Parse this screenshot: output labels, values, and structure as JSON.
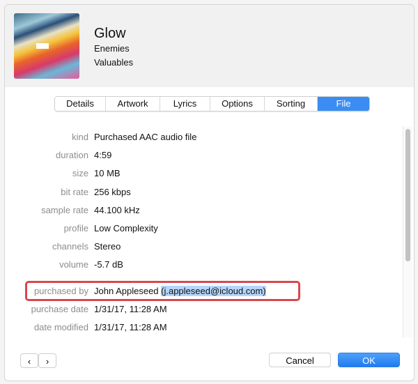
{
  "header": {
    "title": "Glow",
    "artist": "Enemies",
    "album": "Valuables"
  },
  "tabs": [
    {
      "label": "Details",
      "w": 72
    },
    {
      "label": "Artwork",
      "w": 77
    },
    {
      "label": "Lyrics",
      "w": 71
    },
    {
      "label": "Options",
      "w": 77
    },
    {
      "label": "Sorting",
      "w": 75
    },
    {
      "label": "File",
      "w": 74,
      "active": true
    }
  ],
  "fields": [
    {
      "label": "kind",
      "value": "Purchased AAC audio file"
    },
    {
      "label": "duration",
      "value": "4:59"
    },
    {
      "label": "size",
      "value": "10 MB"
    },
    {
      "label": "bit rate",
      "value": "256 kbps"
    },
    {
      "label": "sample rate",
      "value": "44.100 kHz"
    },
    {
      "label": "profile",
      "value": "Low Complexity"
    },
    {
      "label": "channels",
      "value": "Stereo"
    },
    {
      "label": "volume",
      "value": "-5.7 dB"
    }
  ],
  "purchased": {
    "label": "purchased by",
    "name": "John Appleseed ",
    "email": "(j.appleseed@icloud.com)"
  },
  "dates": [
    {
      "label": "purchase date",
      "value": "1/31/17, 11:28 AM"
    },
    {
      "label": "date modified",
      "value": "1/31/17, 11:28 AM"
    }
  ],
  "buttons": {
    "prev": "‹",
    "next": "›",
    "cancel": "Cancel",
    "ok": "OK"
  },
  "colors": {
    "accent": "#3b8cf3",
    "highlight": "#d9474b"
  }
}
